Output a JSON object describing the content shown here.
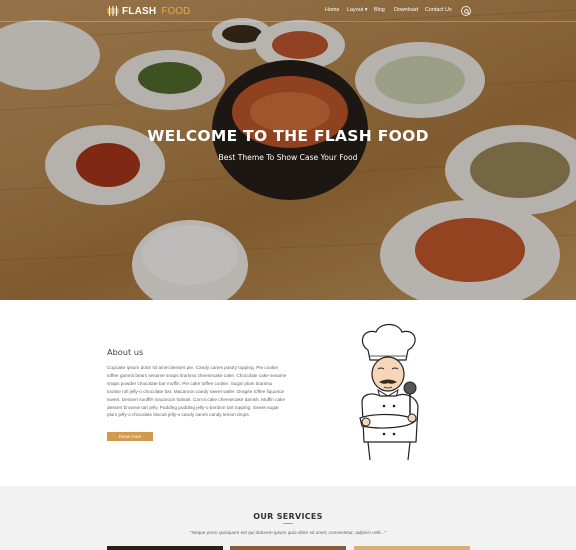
{
  "nav": {
    "logo_word1": "FLASH",
    "logo_word2": "FOOD",
    "items": [
      "Home",
      "Layout",
      "Blog",
      "Download",
      "Contact Us"
    ],
    "layout_caret": "▾"
  },
  "hero": {
    "title": "WELCOME TO THE FLASH FOOD",
    "subtitle": "Best Theme To Show Case Your Food"
  },
  "about": {
    "title": "About us",
    "text": "Cupcake ipsum dolor sit amet dessert pie. Candy canes pastry topping. Pie cookie toffee gummi bears sesame snaps tiramisu cheesecake cake. Chocolate cake sesame snaps powder chocolate bar muffin. Pie cake toffee cookie. Sugar plum tiramisu tootsie roll jelly-o chocolate bar. Macaroon candy sweet wafer. Dragée toffee liquorice sweet. Dessert soufflé macaroon halvah. Carrot cake cheesecake danish. Muffin cake dessert brownie tart jelly. Pudding pudding jelly-o bonbon tart topping. Sweet sugar plum jelly-o chocolate biscuit jelly-o candy canes candy lemon drops.",
    "button": "Know more"
  },
  "services": {
    "title": "OUR SERVICES",
    "quote": "\"Neque porro quisquam est qui dolorem ipsum quia dolor sit amet, consectetur, adipisci velit...\""
  },
  "colors": {
    "accent": "#d29a4e",
    "services_bg": "#f2f2f2"
  },
  "icons": [
    "logo-utensils-icon",
    "search-icon",
    "chef-illustration"
  ]
}
